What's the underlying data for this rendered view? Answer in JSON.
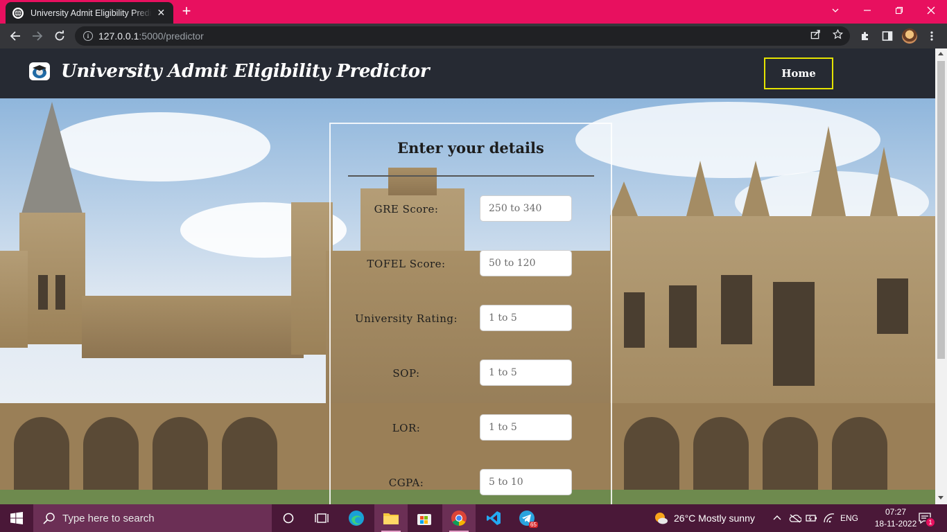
{
  "browser": {
    "tab_title": "University Admit Eligibility Predictor",
    "tab_close": "✕",
    "new_tab": "+",
    "url_host": "127.0.0.1",
    "url_rest": ":5000/predictor",
    "accent_color": "#e8105f"
  },
  "site": {
    "title": "University Admit Eligibility Predictor",
    "home_label": "Home",
    "accent_color": "#e5e400"
  },
  "form": {
    "heading": "Enter your details",
    "fields": [
      {
        "label": "GRE Score:",
        "placeholder": "250 to 340"
      },
      {
        "label": "TOFEL Score:",
        "placeholder": "50 to 120"
      },
      {
        "label": "University Rating:",
        "placeholder": "1 to 5"
      },
      {
        "label": "SOP:",
        "placeholder": "1 to 5"
      },
      {
        "label": "LOR:",
        "placeholder": "1 to 5"
      },
      {
        "label": "CGPA:",
        "placeholder": "5 to 10"
      }
    ]
  },
  "taskbar": {
    "search_placeholder": "Type here to search",
    "weather": "26°C  Mostly sunny",
    "language": "ENG",
    "time": "07:27",
    "date": "18-11-2022",
    "notification_count": "1",
    "telegram_badge": "65"
  }
}
